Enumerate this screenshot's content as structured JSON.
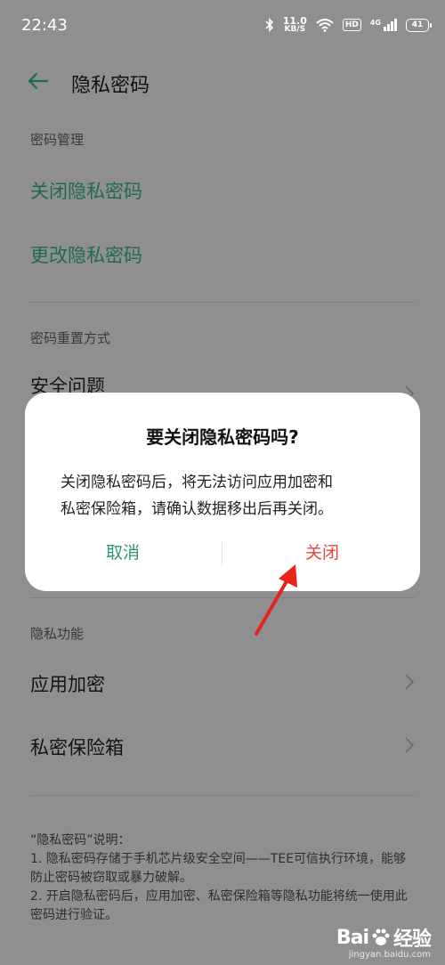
{
  "status_bar": {
    "time": "22:43",
    "net_speed_value": "11.0",
    "net_speed_unit": "KB/S",
    "hd_label": "HD",
    "network_type": "4G",
    "battery_level": "41"
  },
  "header": {
    "title": "隐私密码"
  },
  "sections": {
    "password_management": {
      "label": "密码管理",
      "close_password": "关闭隐私密码",
      "change_password": "更改隐私密码"
    },
    "reset_method": {
      "label": "密码重置方式",
      "security_question": "安全问题"
    },
    "privacy_features": {
      "label": "隐私功能",
      "app_encryption": "应用加密",
      "private_safe": "私密保险箱"
    }
  },
  "note": {
    "heading": "“隐私密码”说明：",
    "line1": "1. 隐私密码存储于手机芯片级安全空间——TEE可信执行环境，能够防止密码被窃取或暴力破解。",
    "line2": "2. 开启隐私密码后，应用加密、私密保险箱等隐私功能将统一使用此密码进行验证。"
  },
  "dialog": {
    "title": "要关闭隐私密码吗?",
    "message_line1": "关闭隐私密码后，将无法访问应用加密和",
    "message_line2": "私密保险箱，请确认数据移出后再关闭。",
    "cancel_label": "取消",
    "confirm_label": "关闭"
  },
  "watermark": {
    "brand_left": "Bai",
    "brand_right": "经验",
    "url": "jingyan.baidu.com"
  },
  "colors": {
    "accent_green": "#2a9a6b",
    "danger_red": "#e0483e",
    "annotation_arrow": "#e8231d"
  },
  "icons": [
    "back-arrow-icon",
    "bluetooth-icon",
    "wifi-icon",
    "signal-icon",
    "battery-icon",
    "chevron-right-icon",
    "baidu-paw-icon"
  ]
}
